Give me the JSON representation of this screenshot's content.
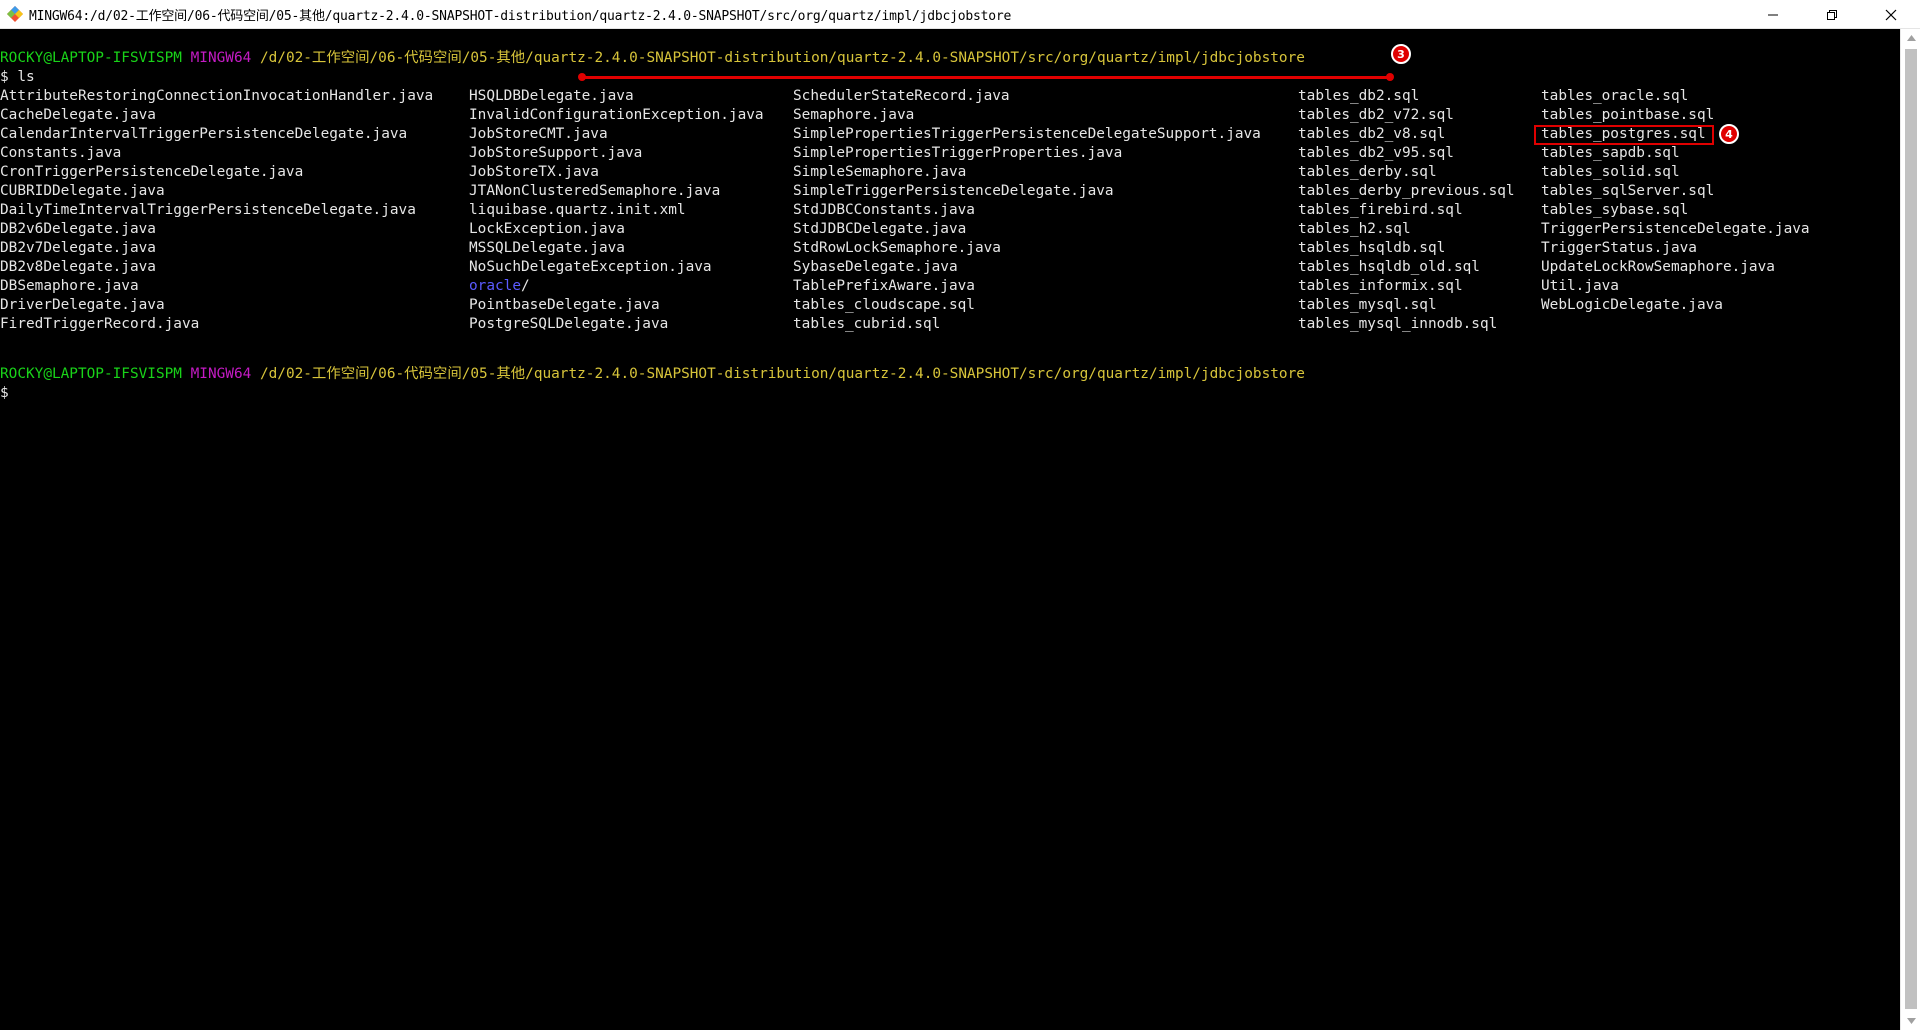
{
  "window": {
    "title": "MINGW64:/d/02-工作空间/06-代码空间/05-其他/quartz-2.4.0-SNAPSHOT-distribution/quartz-2.4.0-SNAPSHOT/src/org/quartz/impl/jdbcjobstore",
    "controls": [
      "minimize-icon",
      "restore-icon",
      "close-icon"
    ]
  },
  "terminal": {
    "prompt1": {
      "user": "ROCKY@LAPTOP-IFSVISPM",
      "shell": "MINGW64",
      "path_prefix": "/d/02-工作空间/06-代码空间/05-其他",
      "path_rest": "/quartz-2.4.0-SNAPSHOT-distribution/quartz-2.4.0-SNAPSHOT/src/org/quartz/impl/jdbcjobstore"
    },
    "command": "$ ls",
    "ls_columns": [
      [
        "AttributeRestoringConnectionInvocationHandler.java",
        "CacheDelegate.java",
        "CalendarIntervalTriggerPersistenceDelegate.java",
        "Constants.java",
        "CronTriggerPersistenceDelegate.java",
        "CUBRIDDelegate.java",
        "DailyTimeIntervalTriggerPersistenceDelegate.java",
        "DB2v6Delegate.java",
        "DB2v7Delegate.java",
        "DB2v8Delegate.java",
        "DBSemaphore.java",
        "DriverDelegate.java",
        "FiredTriggerRecord.java"
      ],
      [
        "HSQLDBDelegate.java",
        "InvalidConfigurationException.java",
        "JobStoreCMT.java",
        "JobStoreSupport.java",
        "JobStoreTX.java",
        "JTANonClusteredSemaphore.java",
        "liquibase.quartz.init.xml",
        "LockException.java",
        "MSSQLDelegate.java",
        "NoSuchDelegateException.java",
        "oracle/",
        "PointbaseDelegate.java",
        "PostgreSQLDelegate.java"
      ],
      [
        "SchedulerStateRecord.java",
        "Semaphore.java",
        "SimplePropertiesTriggerPersistenceDelegateSupport.java",
        "SimplePropertiesTriggerProperties.java",
        "SimpleSemaphore.java",
        "SimpleTriggerPersistenceDelegate.java",
        "StdJDBCConstants.java",
        "StdJDBCDelegate.java",
        "StdRowLockSemaphore.java",
        "SybaseDelegate.java",
        "TablePrefixAware.java",
        "tables_cloudscape.sql",
        "tables_cubrid.sql"
      ],
      [
        "tables_db2.sql",
        "tables_db2_v72.sql",
        "tables_db2_v8.sql",
        "tables_db2_v95.sql",
        "tables_derby.sql",
        "tables_derby_previous.sql",
        "tables_firebird.sql",
        "tables_h2.sql",
        "tables_hsqldb.sql",
        "tables_hsqldb_old.sql",
        "tables_informix.sql",
        "tables_mysql.sql",
        "tables_mysql_innodb.sql"
      ],
      [
        "tables_oracle.sql",
        "tables_pointbase.sql",
        "tables_postgres.sql",
        "tables_sapdb.sql",
        "tables_solid.sql",
        "tables_sqlServer.sql",
        "tables_sybase.sql",
        "TriggerPersistenceDelegate.java",
        "TriggerStatus.java",
        "UpdateLockRowSemaphore.java",
        "Util.java",
        "WebLogicDelegate.java"
      ]
    ],
    "directory_entries": [
      "oracle/"
    ],
    "prompt2": {
      "user": "ROCKY@LAPTOP-IFSVISPM",
      "shell": "MINGW64",
      "path": "/d/02-工作空间/06-代码空间/05-其他/quartz-2.4.0-SNAPSHOT-distribution/quartz-2.4.0-SNAPSHOT/src/org/quartz/impl/jdbcjobstore"
    },
    "cursor_line": "$"
  },
  "annotations": {
    "badge_path": "3",
    "badge_file": "4",
    "color": "#e00000"
  },
  "colors": {
    "user": "#19d319",
    "shell": "#c41bc4",
    "path": "#d7c43a",
    "directory": "#5b5bff",
    "background": "#000000"
  }
}
